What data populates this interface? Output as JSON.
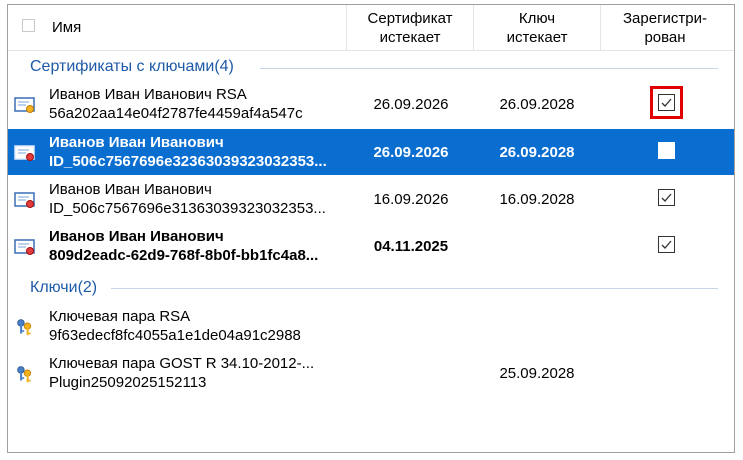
{
  "header": {
    "name": "Имя",
    "cert_expires_l1": "Сертификат",
    "cert_expires_l2": "истекает",
    "key_expires_l1": "Ключ",
    "key_expires_l2": "истекает",
    "registered_l1": "Зарегистри-",
    "registered_l2": "рован"
  },
  "groups": [
    {
      "title": "Сертификаты с ключами(4)",
      "rows": [
        {
          "line1": "Иванов Иван Иванович RSA",
          "line2": "56a202aa14e04f2787fe4459af4a547c",
          "cert_expires": "26.09.2026",
          "key_expires": "26.09.2028",
          "registered": true,
          "icon": "certificate-icon"
        },
        {
          "line1": "Иванов Иван Иванович",
          "line2": "ID_506c7567696e32363039323032353...",
          "cert_expires": "26.09.2026",
          "key_expires": "26.09.2028",
          "registered": false,
          "icon": "certificate-icon"
        },
        {
          "line1": "Иванов Иван Иванович",
          "line2": "ID_506c7567696e31363039323032353...",
          "cert_expires": "16.09.2026",
          "key_expires": "16.09.2028",
          "registered": true,
          "icon": "certificate-icon"
        },
        {
          "line1": "Иванов Иван Иванович",
          "line2": "809d2eadc-62d9-768f-8b0f-bb1fc4a8...",
          "cert_expires": "04.11.2025",
          "key_expires": "",
          "registered": true,
          "icon": "certificate-icon"
        }
      ]
    },
    {
      "title": "Ключи(2)",
      "rows": [
        {
          "line1": "Ключевая пара RSA",
          "line2": "9f63edecf8fc4055a1e1de04a91c2988",
          "cert_expires": "",
          "key_expires": "",
          "icon": "key-pair-icon"
        },
        {
          "line1": "Ключевая пара GOST R 34.10-2012-...",
          "line2": "Plugin25092025152113",
          "cert_expires": "",
          "key_expires": "25.09.2028",
          "icon": "key-pair-icon"
        }
      ]
    }
  ],
  "colors": {
    "selection": "#0a6ed1",
    "group_title": "#1e5aa8",
    "highlight": "#e00000"
  }
}
